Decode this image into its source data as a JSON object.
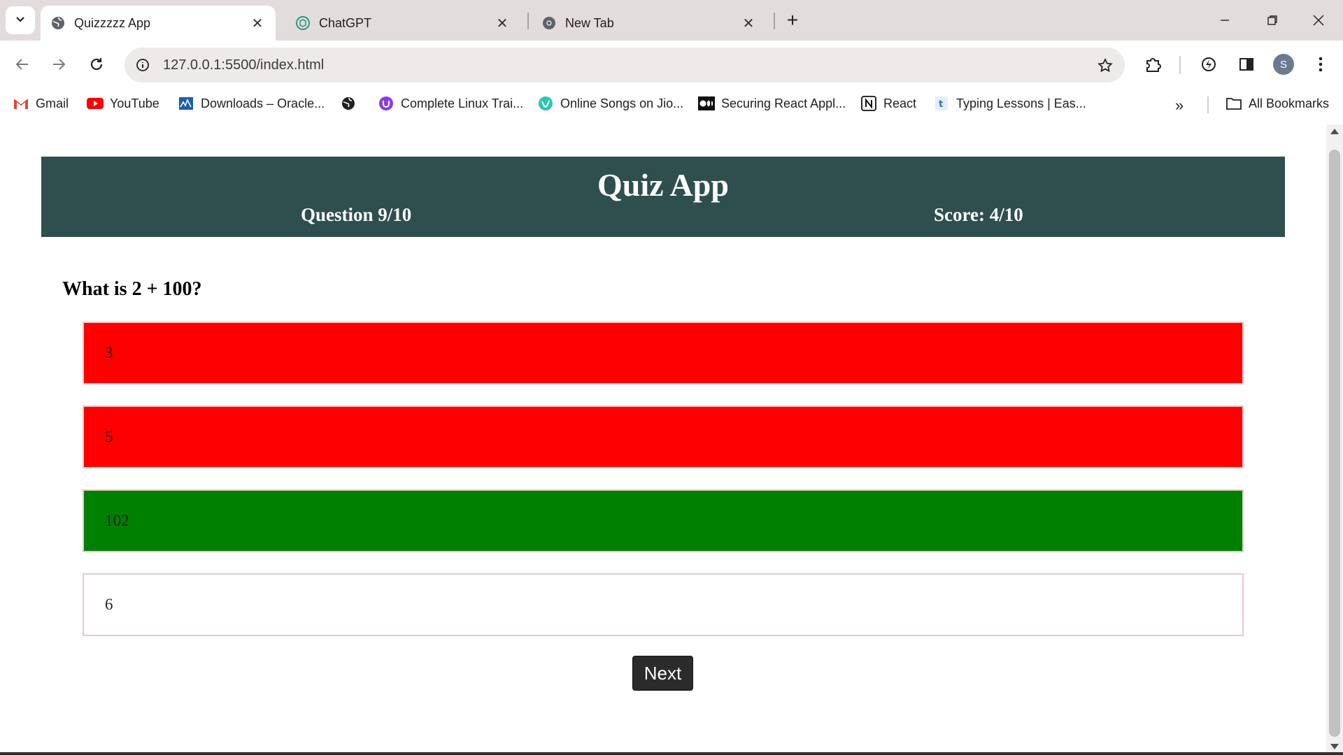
{
  "browser": {
    "tabs": [
      {
        "title": "Quizzzzz App",
        "active": true
      },
      {
        "title": "ChatGPT",
        "active": false
      },
      {
        "title": "New Tab",
        "active": false
      }
    ],
    "address_bar": {
      "url": "127.0.0.1:5500/index.html"
    },
    "avatar_initial": "S",
    "bookmarks": [
      {
        "label": "Gmail",
        "icon": "gmail-icon"
      },
      {
        "label": "YouTube",
        "icon": "youtube-icon"
      },
      {
        "label": "Downloads – Oracle...",
        "icon": "oracle-icon"
      },
      {
        "label": "",
        "icon": "globe-icon"
      },
      {
        "label": "Complete Linux Trai...",
        "icon": "udemy-icon"
      },
      {
        "label": "Online Songs on Jio...",
        "icon": "jiosaavn-icon"
      },
      {
        "label": "Securing React Appl...",
        "icon": "medium-icon"
      },
      {
        "label": "React",
        "icon": "notion-icon"
      },
      {
        "label": "Typing Lessons | Eas...",
        "icon": "typing-icon"
      }
    ],
    "all_bookmarks_label": "All Bookmarks"
  },
  "quiz": {
    "title": "Quiz App",
    "question_count": "Question 9/10",
    "score": "Score: 4/10",
    "question": "What is 2 + 100?",
    "options": [
      {
        "text": "3",
        "state": "wrong"
      },
      {
        "text": "5",
        "state": "wrong"
      },
      {
        "text": "102",
        "state": "correct"
      },
      {
        "text": "6",
        "state": "neutral"
      }
    ],
    "next_label": "Next"
  },
  "colors": {
    "header_bg": "#2f4f4f",
    "wrong": "#ff0000",
    "correct": "#008000",
    "button_bg": "#2b2b2b"
  }
}
